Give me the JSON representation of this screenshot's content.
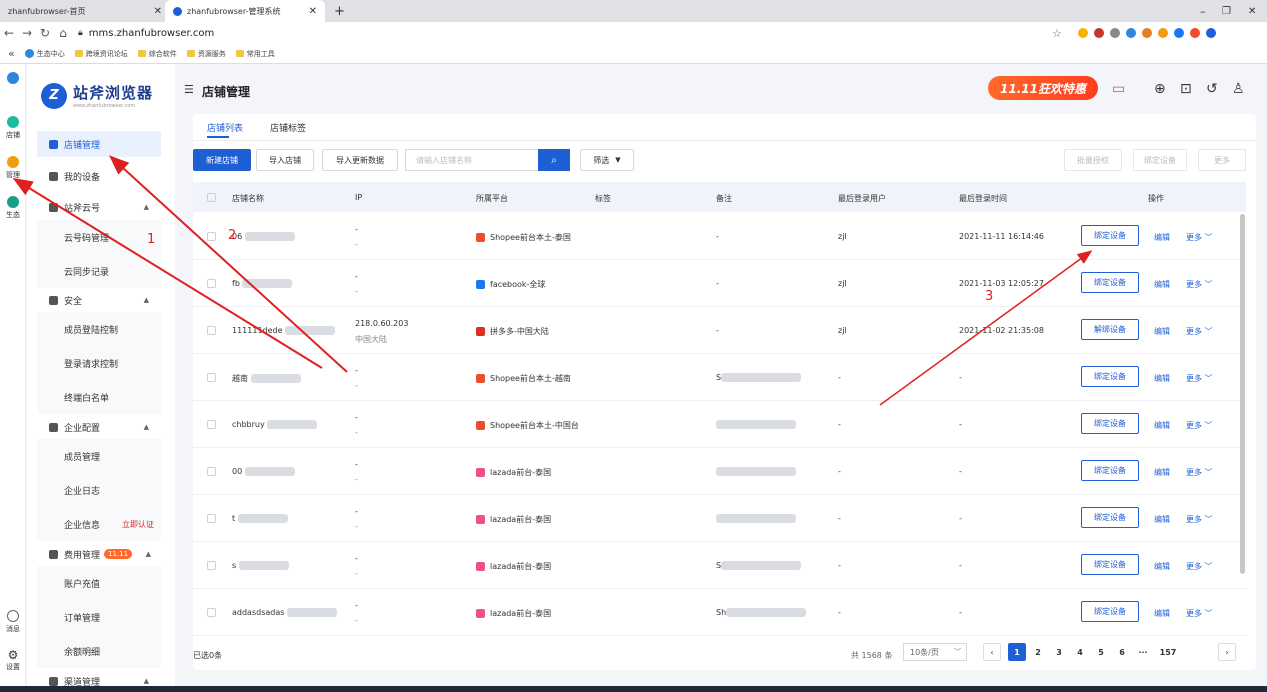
{
  "browser": {
    "tabs": [
      {
        "label": "zhanfubrowser-首页"
      },
      {
        "label": "zhanfubrowser-管理系统"
      }
    ],
    "url": "mms.zhanfubrowser.com",
    "bookmarks": [
      "生态中心",
      "跨境资讯论坛",
      "综合软件",
      "资源服务",
      "常用工具"
    ]
  },
  "rail": {
    "items": [
      "店铺",
      "管理",
      "生态"
    ],
    "bottom": [
      "消息",
      "设置"
    ]
  },
  "logo": {
    "name": "站斧浏览器",
    "sub": "www.zhanfubrowser.com"
  },
  "sidebar": {
    "menus": [
      {
        "label": "店铺管理",
        "active": true
      },
      {
        "label": "我的设备"
      },
      {
        "label": "站斧云号",
        "children": [
          "云号码管理",
          "云同步记录"
        ]
      },
      {
        "label": "安全",
        "children": [
          "成员登陆控制",
          "登录请求控制",
          "终端白名单"
        ]
      },
      {
        "label": "企业配置",
        "children": [
          "成员管理",
          "企业日志",
          "企业信息"
        ]
      },
      {
        "label": "费用管理",
        "badge": "11.11",
        "children": [
          "账户充值",
          "订单管理",
          "余额明细"
        ]
      },
      {
        "label": "渠道管理"
      }
    ],
    "cert_link": "立即认证"
  },
  "header": {
    "title": "店铺管理",
    "promo": "11.11狂欢特惠"
  },
  "tabs": [
    "店铺列表",
    "店铺标签"
  ],
  "toolbar": {
    "new": "新建店铺",
    "import": "导入店铺",
    "import_update": "导入更新数据",
    "search_placeholder": "请输入店铺名称",
    "filter": "筛选",
    "batch_auth": "批量授权",
    "bind_device": "绑定设备",
    "more": "更多"
  },
  "table": {
    "headers": [
      "店铺名称",
      "IP",
      "所属平台",
      "标签",
      "备注",
      "最后登录用户",
      "最后登录时间",
      "操作"
    ],
    "rows": [
      {
        "name": "06",
        "ip1": "-",
        "ip2": "-",
        "platform": "Shopee前台本土-泰国",
        "picon": "#ee4d2d",
        "note": "-",
        "user": "zjl",
        "time": "2021-11-11 16:14:46",
        "action": "绑定设备"
      },
      {
        "name": "fb",
        "ip1": "-",
        "ip2": "-",
        "platform": "facebook-全球",
        "picon": "#1877f2",
        "note": "-",
        "user": "zjl",
        "time": "2021-11-03 12:05:27",
        "action": "绑定设备"
      },
      {
        "name": "111111dede",
        "ip1": "218.0.60.203",
        "ip2": "中国大陆",
        "platform": "拼多多-中国大陆",
        "picon": "#e02e24",
        "note": "-",
        "user": "zjl",
        "time": "2021-11-02 21:35:08",
        "action": "解绑设备"
      },
      {
        "name": "越南",
        "ip1": "-",
        "ip2": "-",
        "platform": "Shopee前台本土-越南",
        "picon": "#ee4d2d",
        "note": "S",
        "user": "-",
        "time": "-",
        "action": "绑定设备"
      },
      {
        "name": "chbbruy",
        "ip1": "-",
        "ip2": "-",
        "platform": "Shopee前台本土-中国台",
        "picon": "#ee4d2d",
        "note": "",
        "user": "-",
        "time": "-",
        "action": "绑定设备"
      },
      {
        "name": "00",
        "ip1": "-",
        "ip2": "-",
        "platform": "lazada前台-泰国",
        "picon": "#f0508a",
        "note": "",
        "user": "-",
        "time": "-",
        "action": "绑定设备"
      },
      {
        "name": "t",
        "ip1": "-",
        "ip2": "-",
        "platform": "lazada前台-泰国",
        "picon": "#f0508a",
        "note": "",
        "user": "-",
        "time": "-",
        "action": "绑定设备"
      },
      {
        "name": "s",
        "ip1": "-",
        "ip2": "-",
        "platform": "lazada前台-泰国",
        "picon": "#f0508a",
        "note": "S",
        "user": "-",
        "time": "-",
        "action": "绑定设备"
      },
      {
        "name": "addasdsadas",
        "ip1": "-",
        "ip2": "-",
        "platform": "lazada前台-泰国",
        "picon": "#f0508a",
        "note": "Sh",
        "user": "-",
        "time": "-",
        "action": "绑定设备"
      }
    ],
    "edit": "编辑",
    "more": "更多"
  },
  "footer": {
    "selected": "已选0条",
    "total": "共 1568 条",
    "pagesize": "10条/页",
    "pages": [
      "1",
      "2",
      "3",
      "4",
      "5",
      "6",
      "···",
      "157"
    ]
  },
  "annotations": [
    "1",
    "2",
    "3"
  ]
}
